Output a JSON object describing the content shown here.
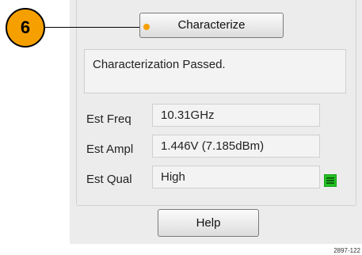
{
  "callout": {
    "number": "6"
  },
  "buttons": {
    "characterize": "Characterize",
    "help": "Help"
  },
  "status": {
    "message": "Characterization Passed."
  },
  "estimates": [
    {
      "label": "Est Freq",
      "value": "10.31GHz"
    },
    {
      "label": "Est Ampl",
      "value": "1.446V (7.185dBm)"
    },
    {
      "label": "Est Qual",
      "value": "High"
    }
  ],
  "quality_icon": {
    "name": "quality-menu-icon",
    "color": "#22c022"
  },
  "figure_id": "2897-122"
}
